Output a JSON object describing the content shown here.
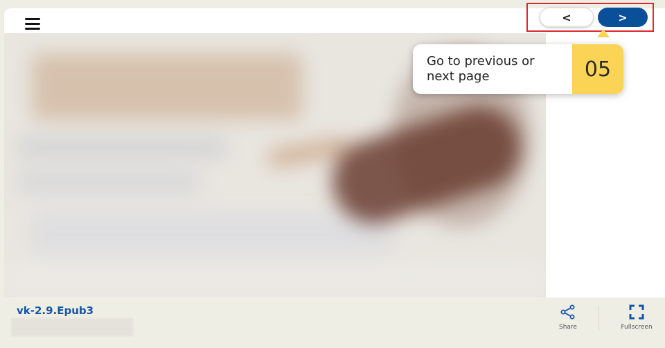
{
  "toolbar": {
    "prev_label": "<",
    "next_label": ">"
  },
  "tooltip": {
    "text": "Go to previous or next page",
    "step": "05"
  },
  "footer": {
    "filename": "vk-2.9.Epub3",
    "share_label": "Share",
    "fullscreen_label": "Fullscreen"
  },
  "icons": {
    "menu": "menu-icon",
    "share": "share-icon",
    "fullscreen": "fullscreen-icon"
  },
  "colors": {
    "accent_blue": "#0a4f9a",
    "highlight_red": "#e0262e",
    "tooltip_yellow": "#fcd455",
    "link_blue": "#1755a6"
  }
}
